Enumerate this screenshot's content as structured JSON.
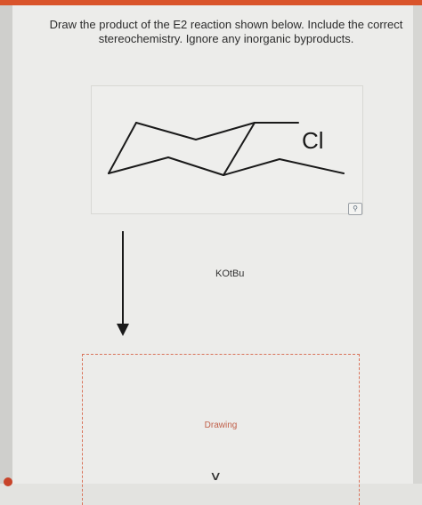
{
  "question": {
    "line1": "Draw the product of the E2 reaction shown below. Include the correct",
    "line2": "stereochemistry. Ignore any inorganic byproducts."
  },
  "molecule": {
    "substituent": "Cl",
    "zoom_icon": "magnifier-icon"
  },
  "reaction": {
    "reagent": "KOtBu"
  },
  "answer": {
    "placeholder": "Drawing",
    "expand_icon": "chevron-down-icon"
  },
  "colors": {
    "accent": "#d9542b",
    "dashed_border": "#d9735a"
  }
}
